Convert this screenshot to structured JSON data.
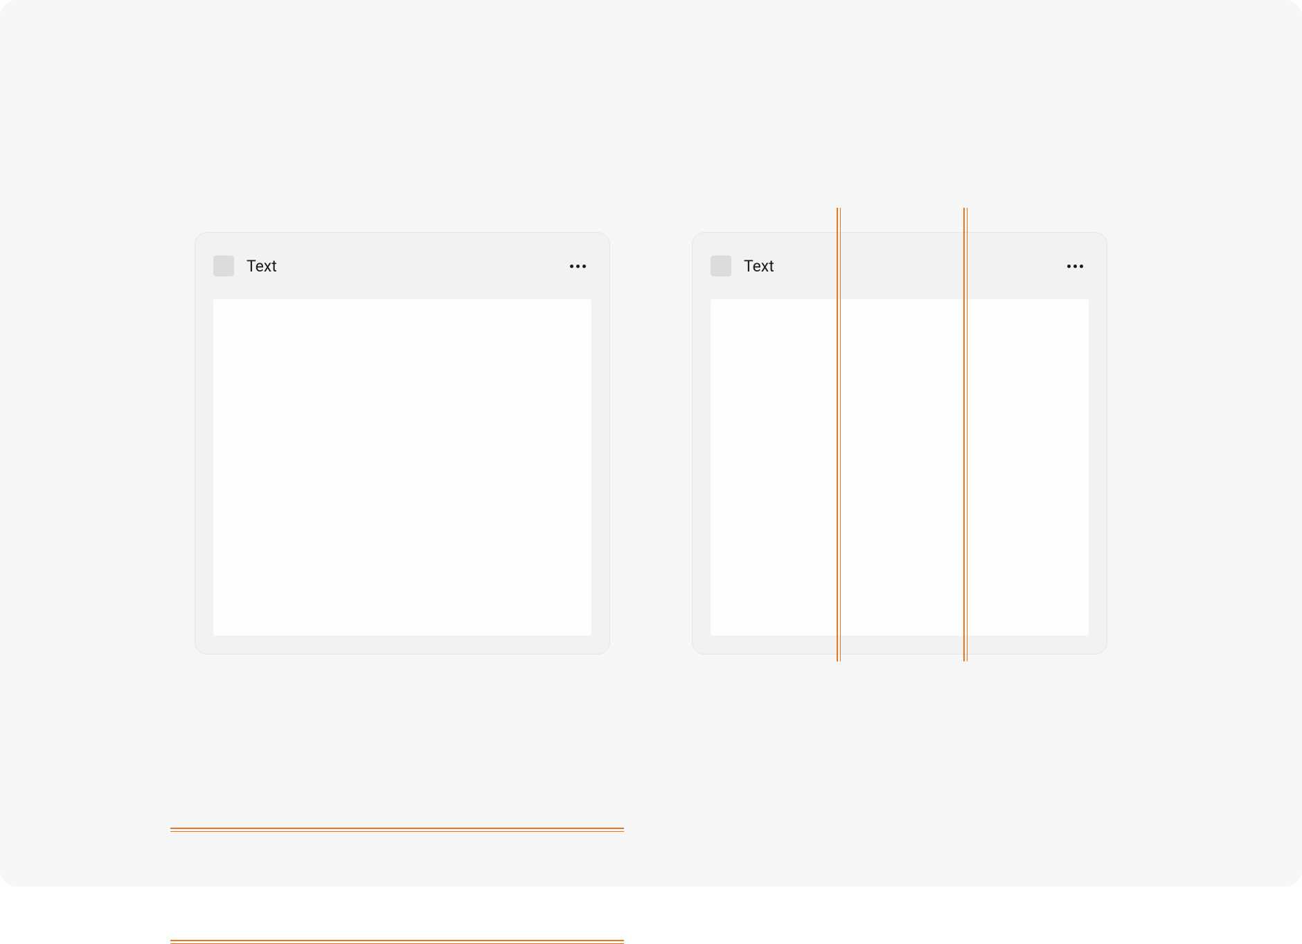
{
  "cards": {
    "left": {
      "title": "Text"
    },
    "right": {
      "title": "Text"
    }
  },
  "guides": {
    "color": "#e67722"
  }
}
